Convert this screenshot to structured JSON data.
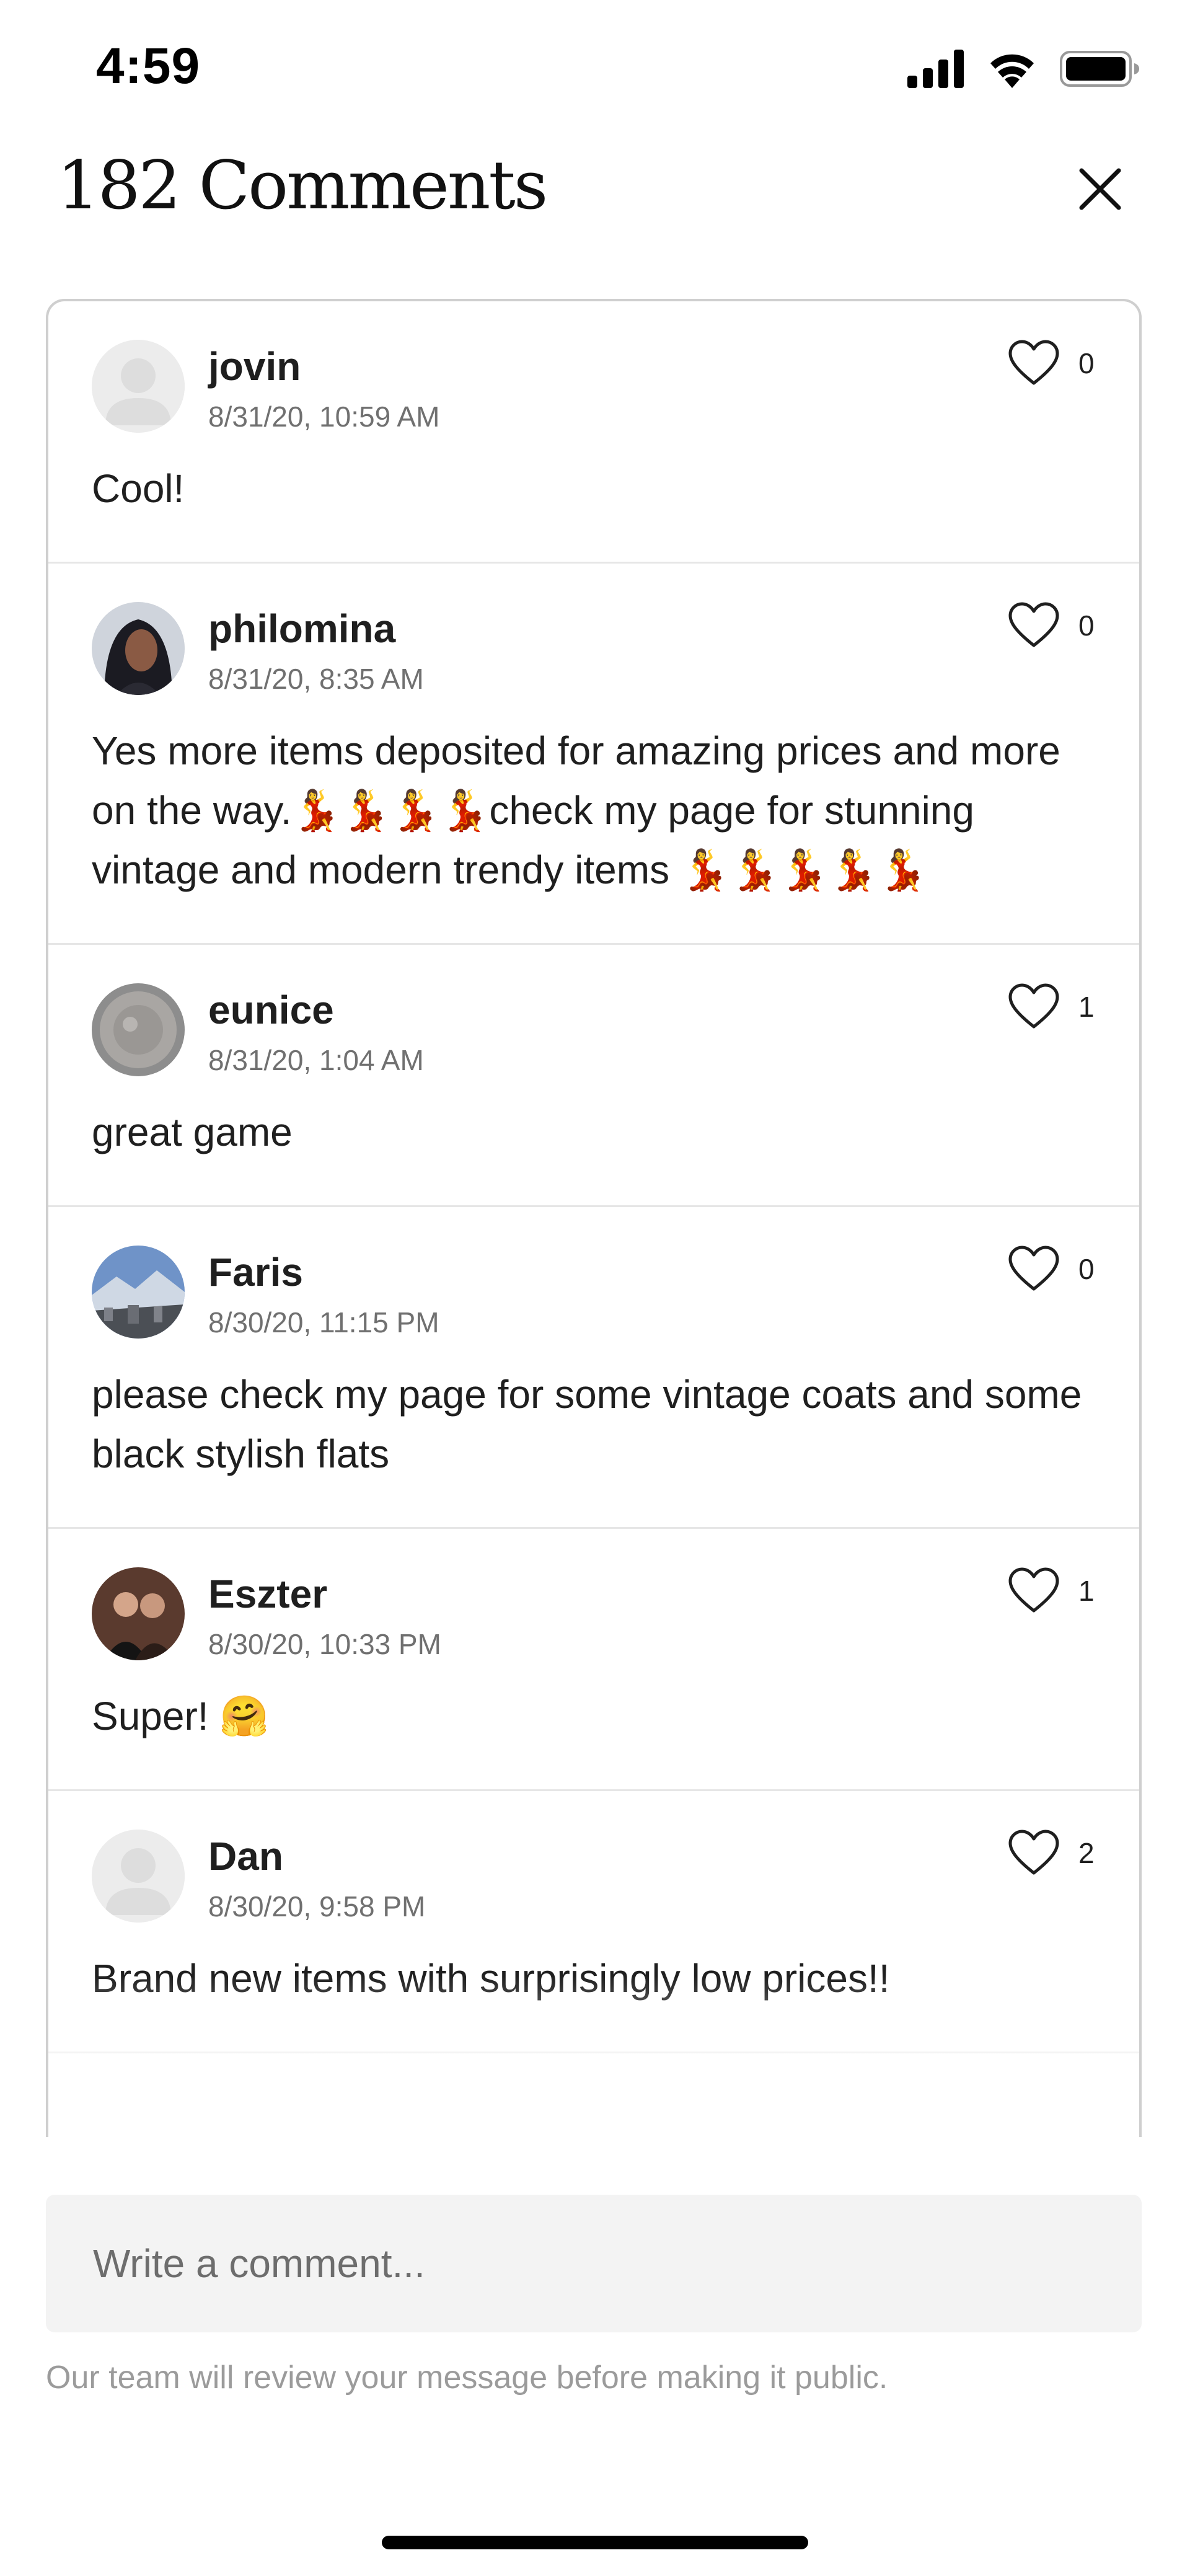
{
  "status_bar": {
    "time": "4:59",
    "icons": [
      "signal-icon",
      "wifi-icon",
      "battery-icon"
    ]
  },
  "header": {
    "title": "182 Comments",
    "close_icon": "close-icon"
  },
  "comments": [
    {
      "username": "jovin",
      "timestamp": "8/31/20, 10:59 AM",
      "likes": "0",
      "text": "Cool!",
      "avatar": "default-avatar"
    },
    {
      "username": "philomina",
      "timestamp": "8/31/20, 8:35 AM",
      "likes": "0",
      "text": "Yes more items deposited for amazing prices and more on the way.💃💃💃💃check my page for stunning vintage and modern trendy items 💃💃💃💃💃",
      "avatar": "photo-avatar"
    },
    {
      "username": "eunice",
      "timestamp": "8/31/20, 1:04 AM",
      "likes": "1",
      "text": "great game",
      "avatar": "photo-avatar"
    },
    {
      "username": "Faris",
      "timestamp": "8/30/20, 11:15 PM",
      "likes": "0",
      "text": "please check my page for some vintage coats and some black stylish flats",
      "avatar": "photo-avatar"
    },
    {
      "username": "Eszter",
      "timestamp": "8/30/20, 10:33 PM",
      "likes": "1",
      "text": "Super! 🤗",
      "avatar": "photo-avatar"
    },
    {
      "username": "Dan",
      "timestamp": "8/30/20, 9:58 PM",
      "likes": "2",
      "text": "Brand new items with surprisingly low prices!!",
      "avatar": "default-avatar"
    }
  ],
  "composer": {
    "placeholder": "Write a comment...",
    "value": ""
  },
  "disclaimer": "Our team will review your message before making it public."
}
